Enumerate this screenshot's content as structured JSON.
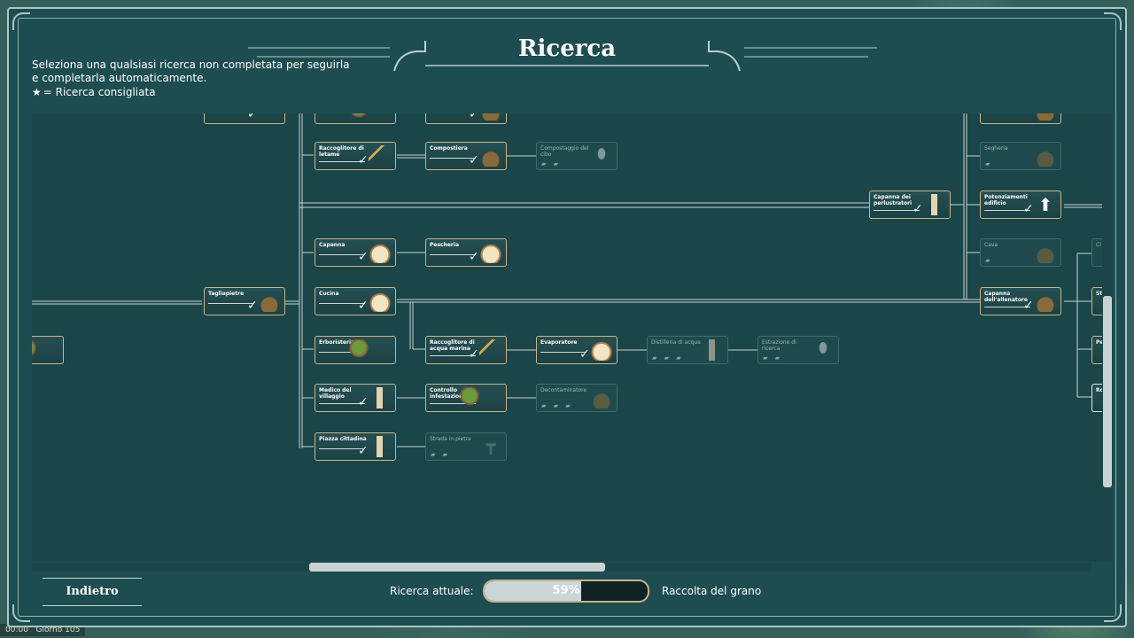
{
  "header": {
    "title": "Ricerca",
    "subtitle": "Seleziona una qualsiasi ricerca non completata per seguirla e completarla automaticamente.",
    "hint_text": "= Ricerca consigliata",
    "hint_icon": "star-icon"
  },
  "nodes": {
    "raccoglitore_letame": "Raccoglitore di letame",
    "compostiera": "Compostiera",
    "compostaggio_cibo": "Compostaggio del cibo",
    "capanna_perlustratori": "Capanna dei perlustratori",
    "segheria": "Segheria",
    "potenziamenti_edificio": "Potenziamenti edificio",
    "capanna": "Capanna",
    "pescheria": "Pescheria",
    "cava": "Cava",
    "tagliapietre": "Tagliapietre",
    "cucina": "Cucina",
    "capanna_allenatore": "Capanna dell'allenatore",
    "erboristeria": "Erboristeria",
    "raccoglitore_acqua": "Raccoglitore di acqua marina",
    "evaporatore": "Evaporatore",
    "distilleria": "Distilleria di acqua",
    "estrazione_ricerca": "Estrazione di ricerca",
    "medico": "Medico del villaggio",
    "controllo_infestazioni": "Controllo infestazioni",
    "decontaminatore": "Decontaminatore",
    "piazza": "Piazza cittadina",
    "strada_pietra": "Strada in pietra",
    "edge_cl": "Cl",
    "edge_st": "St",
    "edge_pe": "Pe",
    "edge_ro": "Ro"
  },
  "footer": {
    "back_label": "Indietro",
    "current_label": "Ricerca attuale:",
    "progress_pct": 59,
    "progress_text": "59%",
    "current_research": "Raccolta del grano"
  },
  "status": {
    "time": "00:00",
    "day": "Giorno 105"
  },
  "colors": {
    "panel": "#1d4d50",
    "tree_bg": "#1a4649",
    "node_border": "#c9b58a",
    "progress_border": "#c7b38a"
  }
}
